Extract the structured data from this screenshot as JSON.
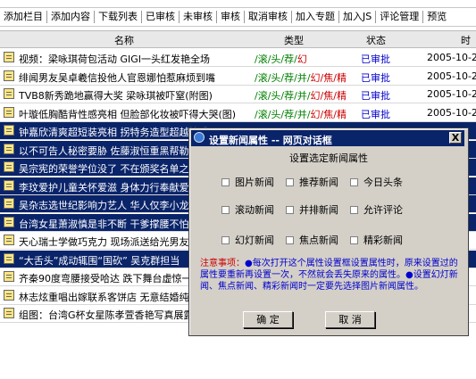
{
  "toolbar": [
    "添加栏目",
    "添加内容",
    "下载列表",
    "已审核",
    "未审核",
    "审核",
    "取消审核",
    "加入专题",
    "加入JS",
    "评论管理",
    "预览"
  ],
  "header": {
    "name": "名称",
    "type": "类型",
    "status": "状态",
    "time": "时"
  },
  "rows": [
    {
      "title": "视频：梁咏琪荷包活动 GIGI一头红发艳全场",
      "type_g": "/滚/头/荐/",
      "type_r": "幻",
      "status": "已审批",
      "time": "2005-10-2",
      "selected": false
    },
    {
      "title": "绯闻男友吴卓羲信投他人官恩娜怕惹麻烦到嘴",
      "type_g": "/滚/头/荐/并/",
      "type_r": "幻/焦/精",
      "status": "已审批",
      "time": "2005-10-2",
      "selected": false
    },
    {
      "title": "TVB8新秀跪地赢得大奖 梁咏琪被吓窒(附图)",
      "type_g": "/滚/头/荐/并/",
      "type_r": "幻/焦/精",
      "status": "已审批",
      "time": "2005-10-2",
      "selected": false
    },
    {
      "title": "叶璇低胸酷背性感亮相 但脸部化妆被吓得大哭(图)",
      "type_g": "/滚/头/荐/并/",
      "type_r": "幻/焦/精",
      "status": "已审批",
      "time": "2005-10-2",
      "selected": false
    },
    {
      "title": "钟嘉欣清爽超短装亮相 拐特务造型超越性感(图)",
      "type_g": "",
      "type_r": "",
      "status": "",
      "time": "",
      "selected": true
    },
    {
      "title": "以不可告人秘密要胁 佐藤淑恒重黑帮勒索",
      "type_g": "",
      "type_r": "",
      "status": "",
      "time": "",
      "selected": true
    },
    {
      "title": "吴宗宪的荣誉学位没了 不在颁奖名单之列",
      "type_g": "",
      "type_r": "",
      "status": "",
      "time": "",
      "selected": true
    },
    {
      "title": "李玟爱护儿童关怀爱滋 身体力行奉献爱心",
      "type_g": "",
      "type_r": "",
      "status": "",
      "time": "",
      "selected": true
    },
    {
      "title": "吴杂志选世纪影响力艺人 华人仅李小龙入",
      "type_g": "",
      "type_r": "",
      "status": "",
      "time": "",
      "selected": true
    },
    {
      "title": "台湾女星萧淑慎是非不断 干爹撑腰不怕警",
      "type_g": "",
      "type_r": "",
      "status": "",
      "time": "",
      "selected": true
    },
    {
      "title": "天心瑞士学做巧克力 现场派送给光男友",
      "type_g": "",
      "type_r": "",
      "status": "",
      "time": "",
      "selected": false
    },
    {
      "title": "“大舌头”成动辄围“国砍” 吴克群担当",
      "type_g": "",
      "type_r": "",
      "status": "",
      "time": "",
      "selected": true
    },
    {
      "title": "齐秦90度弯腰接受哈达 跌下舞台虚惊一场",
      "type_g": "",
      "type_r": "",
      "status": "",
      "time": "",
      "selected": false
    },
    {
      "title": "林志炫重唱出嫁联系客饼店 无意结婚纯属",
      "type_g": "",
      "type_r": "",
      "status": "",
      "time": "",
      "selected": false
    },
    {
      "title": "组图：台湾G杯女星陈孝萱香艳写真展露",
      "type_g": "",
      "type_r": "",
      "status": "",
      "time": "",
      "selected": false
    }
  ],
  "dialog": {
    "title": "设置新闻属性 -- 网页对话框",
    "close": "X",
    "heading": "设置选定新闻属性",
    "options": [
      "图片新闻",
      "推荐新闻",
      "今日头条",
      "滚动新闻",
      "并排新闻",
      "允许评论",
      "幻灯新闻",
      "焦点新闻",
      "精彩新闻"
    ],
    "notice_label": "注意事项：",
    "notice_1": "●每次打开这个属性设置框设置属性时，原来设置过的属性要重新再设置一次，不然就会丢失原来的属性。",
    "notice_2": "●设置幻灯新闻、焦点新闻、精彩新闻时一定要先选择图片新闻属性。",
    "ok": "确 定",
    "cancel": "取 消"
  }
}
